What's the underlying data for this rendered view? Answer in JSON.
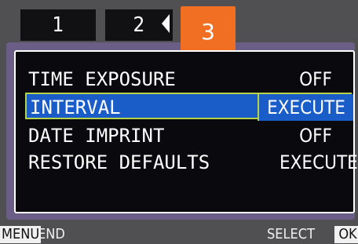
{
  "tabs": [
    {
      "label": "1"
    },
    {
      "label": "2"
    },
    {
      "label": "3",
      "active": true
    }
  ],
  "menu": {
    "items": [
      {
        "label": "TIME EXPOSURE",
        "value": "OFF"
      },
      {
        "label": "INTERVAL",
        "value": "EXECUTE",
        "selected": true
      },
      {
        "label": "DATE IMPRINT",
        "value": "OFF"
      },
      {
        "label": "RESTORE DEFAULTS",
        "value": "EXECUTE"
      }
    ]
  },
  "footer": {
    "menu_key": "MENU",
    "menu_action": "END",
    "select_label": "SELECT",
    "ok_key": "OK"
  },
  "colors": {
    "accent_tab": "#f06f22",
    "selection": "#1b5dc8",
    "selection_border": "#b5d34a"
  }
}
